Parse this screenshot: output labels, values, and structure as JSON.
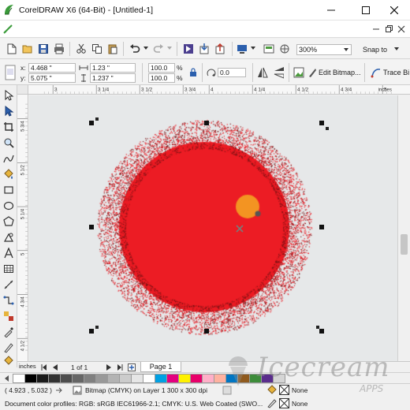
{
  "window": {
    "title": "CorelDRAW X6 (64-Bit) - [Untitled-1]"
  },
  "standard_toolbar": {
    "zoom": "300%",
    "snap_to": "Snap to"
  },
  "property_bar": {
    "x_label": "x:",
    "x_value": "4.468 \"",
    "y_label": "y:",
    "y_value": "5.075 \"",
    "width_value": "1.23 \"",
    "height_value": "1.237 \"",
    "scale_x": "100.0",
    "scale_y": "100.0",
    "percent": "%",
    "rotation": "0.0",
    "edit_bitmap_label": "Edit Bitmap...",
    "trace_bitmap_label": "Trace Bi"
  },
  "ruler": {
    "h_labels": [
      "3",
      "3 1/4",
      "3 1/2",
      "3 3/4",
      "4",
      "4 1/4",
      "4 1/2",
      "4 3/4",
      "5",
      "5 1/4",
      "5 1/2"
    ],
    "units": "inches",
    "v_labels": [
      "5 3/4",
      "5 1/2",
      "5 1/4",
      "5",
      "4 3/4",
      "4 1/2"
    ]
  },
  "page_nav": {
    "page_count": "1 of 1",
    "page_tab": "Page 1",
    "units": "inches"
  },
  "palette": {
    "colors": [
      "#ffffff",
      "#000000",
      "#1a1a1a",
      "#333333",
      "#4d4d4d",
      "#666666",
      "#808080",
      "#999999",
      "#b3b3b3",
      "#cccccc",
      "#e6e6e6",
      "#ffffff",
      "#00a0e3",
      "#e4007f",
      "#fff100",
      "#e8006a",
      "#ffb0c8",
      "#ffb2a0",
      "#0075c2",
      "#8f5a1e",
      "#3d8c3a",
      "#5a2d8c",
      "#d5d5d5"
    ]
  },
  "status": {
    "coords": "( 4.923 , 5.032 )",
    "object_info": "Bitmap (CMYK) on Layer 1 300 x 300 dpi",
    "color_profiles": "Document color profiles: RGB: sRGB IEC61966-2.1; CMYK: U.S. Web Coated (SWO...",
    "fill_label": "None",
    "outline_label": "None"
  },
  "watermark": {
    "text": "Icecream",
    "subtext": "APPS"
  },
  "colors": {
    "ball": "#ec1c24",
    "highlight": "#f39422",
    "accent_blue": "#2b5fad"
  }
}
